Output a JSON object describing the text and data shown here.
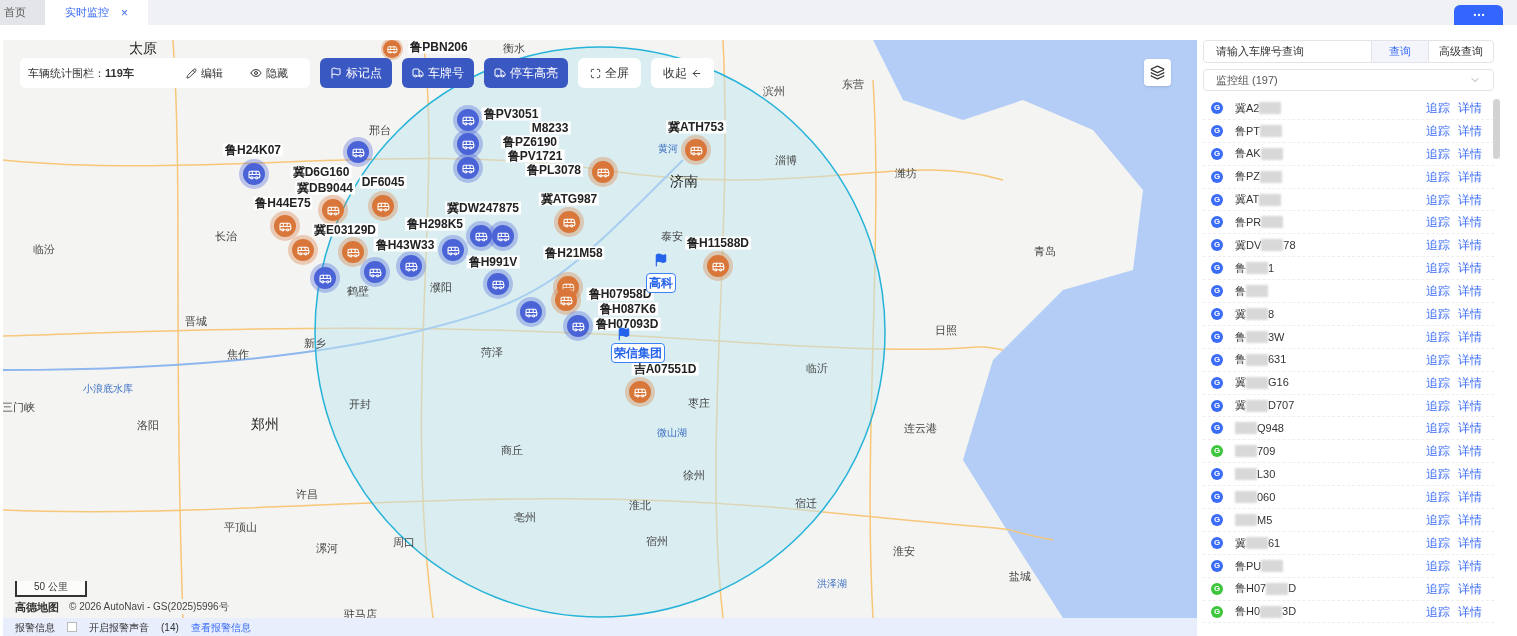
{
  "tabs": [
    {
      "label": "首页",
      "selected": false
    },
    {
      "label": "实时监控",
      "selected": true,
      "close": "×"
    }
  ],
  "toolbar": {
    "stats": "车辆统计围栏：**119车**",
    "edit": "编辑",
    "hide": "隐藏",
    "buttons": [
      {
        "label": "标记点",
        "kind": "flag"
      },
      {
        "label": "车牌号",
        "kind": "truck"
      },
      {
        "label": "停车高亮",
        "kind": "truck"
      }
    ],
    "fullscreen": "全屏",
    "collapse": "收起"
  },
  "map": {
    "cities": [
      {
        "name": "太原",
        "kind": "major"
      },
      {
        "name": "衡水",
        "kind": "city"
      },
      {
        "name": "滨州",
        "kind": "city"
      },
      {
        "name": "东营",
        "kind": "city"
      },
      {
        "name": "邢台",
        "kind": "city"
      },
      {
        "name": "黄河",
        "kind": "water"
      },
      {
        "name": "淄博",
        "kind": "city"
      },
      {
        "name": "济南",
        "kind": "major"
      },
      {
        "name": "潍坊",
        "kind": "city"
      },
      {
        "name": "临汾",
        "kind": "city"
      },
      {
        "name": "长治",
        "kind": "city"
      },
      {
        "name": "泰安",
        "kind": "city"
      },
      {
        "name": "青岛",
        "kind": "city"
      },
      {
        "name": "鹤壁",
        "kind": "city"
      },
      {
        "name": "濮阳",
        "kind": "city"
      },
      {
        "name": "晋城",
        "kind": "city"
      },
      {
        "name": "日照",
        "kind": "city"
      },
      {
        "name": "焦作",
        "kind": "city"
      },
      {
        "name": "新乡",
        "kind": "city"
      },
      {
        "name": "菏泽",
        "kind": "city"
      },
      {
        "name": "临沂",
        "kind": "city"
      },
      {
        "name": "小浪底水库",
        "kind": "water"
      },
      {
        "name": "三门峡",
        "kind": "city"
      },
      {
        "name": "开封",
        "kind": "city"
      },
      {
        "name": "枣庄",
        "kind": "city"
      },
      {
        "name": "洛阳",
        "kind": "city"
      },
      {
        "name": "郑州",
        "kind": "major"
      },
      {
        "name": "微山湖",
        "kind": "water"
      },
      {
        "name": "连云港",
        "kind": "city"
      },
      {
        "name": "商丘",
        "kind": "city"
      },
      {
        "name": "徐州",
        "kind": "city"
      },
      {
        "name": "许昌",
        "kind": "city"
      },
      {
        "name": "淮北",
        "kind": "city"
      },
      {
        "name": "宿迁",
        "kind": "city"
      },
      {
        "name": "平顶山",
        "kind": "city"
      },
      {
        "name": "亳州",
        "kind": "city"
      },
      {
        "name": "漯河",
        "kind": "city"
      },
      {
        "name": "周口",
        "kind": "city"
      },
      {
        "name": "宿州",
        "kind": "city"
      },
      {
        "name": "淮安",
        "kind": "city"
      },
      {
        "name": "洪泽湖",
        "kind": "water"
      },
      {
        "name": "盐城",
        "kind": "city"
      },
      {
        "name": "驻马店",
        "kind": "city"
      }
    ],
    "vehicles": [
      {
        "plate": "鲁PBN206",
        "color": "#d9773a"
      },
      {
        "plate": "鲁H24K07",
        "color": "#4a63d6"
      },
      {
        "plate": "冀D6G160",
        "color": "#4a63d6"
      },
      {
        "plate": "冀DB9044",
        "color": "#d9773a"
      },
      {
        "plate": "DF6045",
        "color": "#d9773a"
      },
      {
        "plate": "鲁H44E75",
        "color": "#d9773a"
      },
      {
        "plate": "冀E03129D",
        "color": "#d9773a"
      },
      {
        "plate": "冀DW247875",
        "color": "#4a63d6"
      },
      {
        "plate": "鲁H298K5",
        "color": "#4a63d6"
      },
      {
        "plate": "鲁H43W33",
        "color": "#4a63d6"
      },
      {
        "plate": "鲁H991V",
        "color": "#4a63d6"
      },
      {
        "plate": "鲁H21M58",
        "color": "#d9773a"
      },
      {
        "plate": "冀ATH753",
        "color": "#d9773a"
      },
      {
        "plate": "鲁PV3051",
        "color": "#4a63d6"
      },
      {
        "plate": "M8233",
        "color": "#4a63d6"
      },
      {
        "plate": "鲁PZ6190"
      },
      {
        "plate": "鲁PV1721",
        "color": "#4a63d6"
      },
      {
        "plate": "鲁PL3078",
        "color": "#d9773a"
      },
      {
        "plate": "冀ATG987",
        "color": "#d9773a"
      },
      {
        "plate": "鲁H11588D",
        "color": "#d9773a"
      },
      {
        "plate": "鲁H07958D",
        "color": "#d9773a"
      },
      {
        "plate": "鲁H087K6"
      },
      {
        "plate": "鲁H07093D",
        "color": "#4a63d6"
      },
      {
        "plate": "吉A07551D",
        "color": "#d9773a"
      },
      {
        "color": "#d9773a"
      },
      {
        "color": "#4a63d6"
      },
      {
        "color": "#4a63d6"
      },
      {
        "color": "#4a63d6"
      },
      {
        "color": "#4a63d6"
      }
    ],
    "places": [
      "高科",
      "荣信集团"
    ],
    "scale": "50 公里",
    "logo": "高德地图",
    "copyright": "© 2026 AutoNavi - GS(2025)5996号"
  },
  "alarm_bar": {
    "title": "报警信息",
    "sound_checked": false,
    "sound": "开启报警声音",
    "count": "(14)",
    "link": "查看报警信息"
  },
  "panel": {
    "search_placeholder": "请输入车牌号查询",
    "search": "查询",
    "advanced": "高级查询",
    "group": "监控组 (197)",
    "rows": [
      {
        "badge": "G",
        "color": "#3b6cf6",
        "plate": [
          {
            "kind": "text",
            "text": "冀A2"
          },
          {
            "kind": "blur"
          }
        ],
        "track": "追踪",
        "detail": "详情"
      },
      {
        "badge": "G",
        "color": "#3b6cf6",
        "plate": [
          {
            "kind": "text",
            "text": "鲁PT"
          },
          {
            "kind": "blur"
          }
        ],
        "track": "追踪",
        "detail": "详情"
      },
      {
        "badge": "G",
        "color": "#3b6cf6",
        "plate": [
          {
            "kind": "text",
            "text": "鲁AK"
          },
          {
            "kind": "blur"
          }
        ],
        "track": "追踪",
        "detail": "详情"
      },
      {
        "badge": "G",
        "color": "#3b6cf6",
        "plate": [
          {
            "kind": "text",
            "text": "鲁PZ"
          },
          {
            "kind": "blur"
          }
        ],
        "track": "追踪",
        "detail": "详情"
      },
      {
        "badge": "G",
        "color": "#3b6cf6",
        "plate": [
          {
            "kind": "text",
            "text": "冀AT"
          },
          {
            "kind": "blur"
          }
        ],
        "track": "追踪",
        "detail": "详情"
      },
      {
        "badge": "G",
        "color": "#3b6cf6",
        "plate": [
          {
            "kind": "text",
            "text": "鲁PR"
          },
          {
            "kind": "blur"
          }
        ],
        "track": "追踪",
        "detail": "详情"
      },
      {
        "badge": "G",
        "color": "#3b6cf6",
        "plate": [
          {
            "kind": "text",
            "text": "冀DV"
          },
          {
            "kind": "blur"
          },
          {
            "kind": "text",
            "text": "78"
          }
        ],
        "track": "追踪",
        "detail": "详情"
      },
      {
        "badge": "G",
        "color": "#3b6cf6",
        "plate": [
          {
            "kind": "text",
            "text": "鲁"
          },
          {
            "kind": "blur"
          },
          {
            "kind": "text",
            "text": "1"
          }
        ],
        "track": "追踪",
        "detail": "详情"
      },
      {
        "badge": "G",
        "color": "#3b6cf6",
        "plate": [
          {
            "kind": "text",
            "text": "鲁"
          },
          {
            "kind": "blur"
          }
        ],
        "track": "追踪",
        "detail": "详情"
      },
      {
        "badge": "G",
        "color": "#3b6cf6",
        "plate": [
          {
            "kind": "text",
            "text": "冀"
          },
          {
            "kind": "blur"
          },
          {
            "kind": "text",
            "text": "8"
          }
        ],
        "track": "追踪",
        "detail": "详情"
      },
      {
        "badge": "G",
        "color": "#3b6cf6",
        "plate": [
          {
            "kind": "text",
            "text": "鲁"
          },
          {
            "kind": "blur"
          },
          {
            "kind": "text",
            "text": "3W"
          }
        ],
        "track": "追踪",
        "detail": "详情"
      },
      {
        "badge": "G",
        "color": "#3b6cf6",
        "plate": [
          {
            "kind": "text",
            "text": "鲁"
          },
          {
            "kind": "blur"
          },
          {
            "kind": "text",
            "text": "631"
          }
        ],
        "track": "追踪",
        "detail": "详情"
      },
      {
        "badge": "G",
        "color": "#3b6cf6",
        "plate": [
          {
            "kind": "text",
            "text": "冀"
          },
          {
            "kind": "blur"
          },
          {
            "kind": "text",
            "text": "G16"
          }
        ],
        "track": "追踪",
        "detail": "详情"
      },
      {
        "badge": "G",
        "color": "#3b6cf6",
        "plate": [
          {
            "kind": "text",
            "text": "冀"
          },
          {
            "kind": "blur"
          },
          {
            "kind": "text",
            "text": "D707"
          }
        ],
        "track": "追踪",
        "detail": "详情"
      },
      {
        "badge": "G",
        "color": "#3b6cf6",
        "plate": [
          {
            "kind": "blur"
          },
          {
            "kind": "text",
            "text": "Q948"
          }
        ],
        "track": "追踪",
        "detail": "详情"
      },
      {
        "badge": "G",
        "color": "#3dc63d",
        "plate": [
          {
            "kind": "blur"
          },
          {
            "kind": "text",
            "text": "709"
          }
        ],
        "track": "追踪",
        "detail": "详情"
      },
      {
        "badge": "G",
        "color": "#3b6cf6",
        "plate": [
          {
            "kind": "blur"
          },
          {
            "kind": "text",
            "text": "L30"
          }
        ],
        "track": "追踪",
        "detail": "详情"
      },
      {
        "badge": "G",
        "color": "#3b6cf6",
        "plate": [
          {
            "kind": "blur"
          },
          {
            "kind": "text",
            "text": "060"
          }
        ],
        "track": "追踪",
        "detail": "详情"
      },
      {
        "badge": "G",
        "color": "#3b6cf6",
        "plate": [
          {
            "kind": "blur"
          },
          {
            "kind": "text",
            "text": "M5"
          }
        ],
        "track": "追踪",
        "detail": "详情"
      },
      {
        "badge": "G",
        "color": "#3b6cf6",
        "plate": [
          {
            "kind": "text",
            "text": "冀"
          },
          {
            "kind": "blur"
          },
          {
            "kind": "text",
            "text": "61"
          }
        ],
        "track": "追踪",
        "detail": "详情"
      },
      {
        "badge": "G",
        "color": "#3b6cf6",
        "plate": [
          {
            "kind": "text",
            "text": "鲁PU"
          },
          {
            "kind": "blur"
          }
        ],
        "track": "追踪",
        "detail": "详情"
      },
      {
        "badge": "G",
        "color": "#3dc63d",
        "plate": [
          {
            "kind": "text",
            "text": "鲁H07"
          },
          {
            "kind": "blur"
          },
          {
            "kind": "text",
            "text": "D"
          }
        ],
        "track": "追踪",
        "detail": "详情"
      },
      {
        "badge": "G",
        "color": "#3dc63d",
        "plate": [
          {
            "kind": "text",
            "text": "鲁H0"
          },
          {
            "kind": "blur"
          },
          {
            "kind": "text",
            "text": "3D"
          }
        ],
        "track": "追踪",
        "detail": "详情"
      }
    ]
  }
}
